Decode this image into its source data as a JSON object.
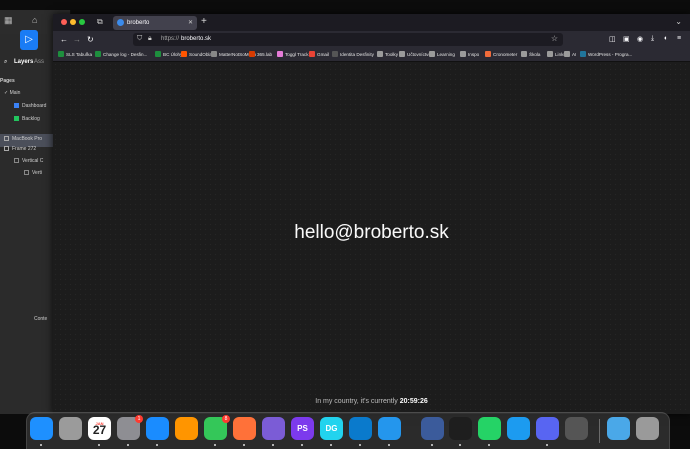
{
  "figma": {
    "panel_tabs": [
      "Layers",
      "Ass"
    ],
    "pages_header": "Pages",
    "pages": [
      "Main",
      "Dashboard",
      "Backlog"
    ],
    "layers": [
      "MacBook Pro",
      "Frame 272",
      "Vertical C",
      "Verti"
    ],
    "bottom_layers": [
      "Conte"
    ]
  },
  "browser": {
    "tab_title": "broberto",
    "url_protocol": "https://",
    "url_host": "broberto.sk",
    "bookmarks": [
      {
        "label": "SLS Tabuľka",
        "color": "#1e8e3e"
      },
      {
        "label": "Change log - Desfin...",
        "color": "#1e8e3e"
      },
      {
        "label": "BC Úlohy",
        "color": "#1e8e3e"
      },
      {
        "label": "SoundOblak",
        "color": "#ff5500"
      },
      {
        "label": "MatterNotSoMuch",
        "color": "#888888"
      },
      {
        "label": "365.lab",
        "color": "#d83b01"
      },
      {
        "label": "Toggl Track",
        "color": "#e57cd8"
      },
      {
        "label": "Gmail",
        "color": "#ea4335"
      },
      {
        "label": "Identita Desfinity",
        "color": "#555555"
      },
      {
        "label": "Toolky",
        "color": "#9b9b9b"
      },
      {
        "label": "Učtovníctvo",
        "color": "#9b9b9b"
      },
      {
        "label": "Learning",
        "color": "#9b9b9b"
      },
      {
        "label": "Inspo",
        "color": "#9b9b9b"
      },
      {
        "label": "Cronometer",
        "color": "#f26b3a"
      },
      {
        "label": "Škola",
        "color": "#9b9b9b"
      },
      {
        "label": "Links",
        "color": "#9b9b9b"
      },
      {
        "label": "AI",
        "color": "#9b9b9b"
      },
      {
        "label": "WordPress - Progra...",
        "color": "#21759b"
      }
    ],
    "email": "hello@broberto.sk",
    "clock_prefix": "In my country, it's currently",
    "clock_time": "20:59:26"
  },
  "dock": {
    "apps": [
      {
        "name": "finder-icon",
        "label": "",
        "color": "#1e90ff"
      },
      {
        "name": "launchpad-icon",
        "label": "",
        "color": "#9b9b9b"
      },
      {
        "name": "calendar-icon",
        "label": "27",
        "color": "#ffffff"
      },
      {
        "name": "system-settings-icon",
        "label": "",
        "color": "#8e8e93"
      },
      {
        "name": "safari-icon",
        "label": "",
        "color": "#1a8cff"
      },
      {
        "name": "books-icon",
        "label": "",
        "color": "#ff9500"
      },
      {
        "name": "messages-icon",
        "label": "",
        "color": "#34c759"
      },
      {
        "name": "firefox-icon",
        "label": "",
        "color": "#ff7139"
      },
      {
        "name": "affinity-icon",
        "label": "",
        "color": "#7b5cd6"
      },
      {
        "name": "phpstorm-icon",
        "label": "PS",
        "color": "#7c3aed"
      },
      {
        "name": "datagrip-icon",
        "label": "DG",
        "color": "#22d3ee"
      },
      {
        "name": "vscode-icon",
        "label": "",
        "color": "#0a7acc"
      },
      {
        "name": "docker-icon",
        "label": "",
        "color": "#2496ed"
      },
      {
        "name": "datastudio-icon",
        "label": "",
        "color": "#3b5b9b"
      },
      {
        "name": "figma-icon",
        "label": "",
        "color": "#1e1e1e"
      },
      {
        "name": "whatsapp-icon",
        "label": "",
        "color": "#25d366"
      },
      {
        "name": "testflight-icon",
        "label": "",
        "color": "#1c9bf0"
      },
      {
        "name": "discord-icon",
        "label": "",
        "color": "#5865f2"
      },
      {
        "name": "calculator-icon",
        "label": "",
        "color": "#555555"
      },
      {
        "name": "downloads-folder-icon",
        "label": "",
        "color": "#4aa8e8"
      },
      {
        "name": "trash-icon",
        "label": "",
        "color": "#9a9a9a"
      }
    ],
    "calendar_month": "JAN",
    "settings_badge": "1",
    "messages_badge": "8"
  }
}
